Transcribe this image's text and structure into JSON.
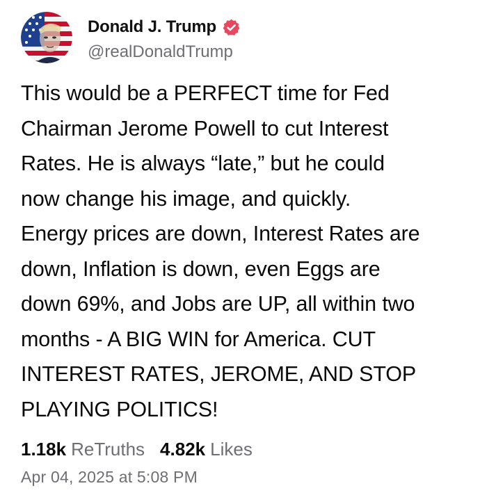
{
  "post": {
    "author": {
      "display_name": "Donald J. Trump",
      "handle": "@realDonaldTrump",
      "verified": true,
      "verified_icon": "verified-badge-icon",
      "avatar_icon": "profile-avatar"
    },
    "text": "This would be a PERFECT time for Fed\nChairman Jerome Powell to cut Interest\nRates. He is always “late,” but he could\nnow change his image, and quickly.\nEnergy prices are down, Interest Rates are\ndown, Inflation is down, even Eggs are\ndown 69%, and Jobs are UP, all within two\nmonths - A BIG WIN for America. CUT\nINTEREST RATES, JEROME, AND STOP\nPLAYING POLITICS!",
    "stats": {
      "retruths_count": "1.18k",
      "retruths_label": "ReTruths",
      "likes_count": "4.82k",
      "likes_label": "Likes"
    },
    "timestamp": "Apr 04, 2025 at 5:08 PM"
  },
  "colors": {
    "verified_badge": "#e8475f",
    "secondary_text": "#6e6e73",
    "primary_text": "#0a0a0a"
  }
}
